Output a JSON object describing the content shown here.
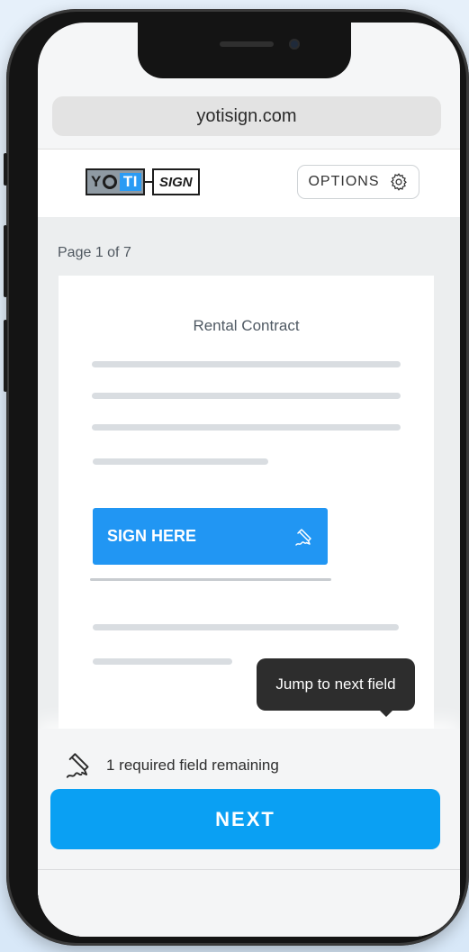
{
  "browser": {
    "url": "yotisign.com"
  },
  "header": {
    "logo": {
      "part1": "YOTI",
      "part2": "SIGN"
    },
    "options_label": "OPTIONS"
  },
  "document": {
    "page_indicator": "Page 1 of 7",
    "title": "Rental Contract",
    "sign_field_label": "SIGN HERE"
  },
  "tooltip": {
    "text": "Jump to next field"
  },
  "footer": {
    "remaining_text": "1 required field remaining",
    "next_label": "NEXT"
  },
  "colors": {
    "accent": "#2196f3",
    "next_button": "#0aa0f3",
    "tooltip_bg": "#2d2d2d"
  },
  "icons": [
    "settings-gear-icon",
    "pen-sign-icon",
    "pen-sign-icon"
  ]
}
